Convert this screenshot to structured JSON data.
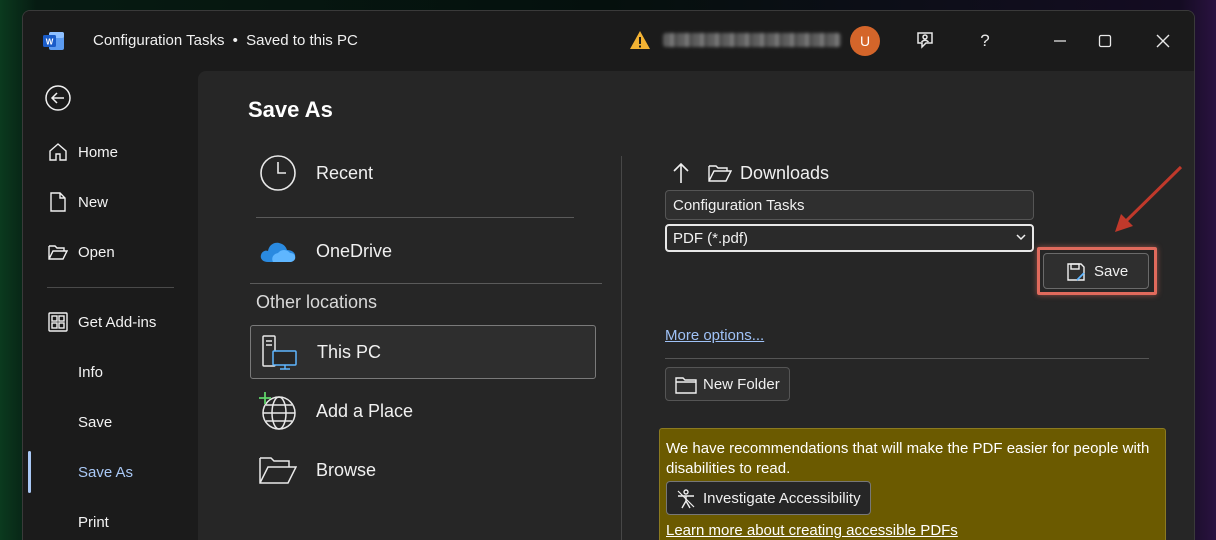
{
  "titlebar": {
    "doc_title": "Configuration Tasks",
    "separator": "•",
    "save_status": "Saved to this PC",
    "account_initial": "U",
    "account_name_redacted": "",
    "help_glyph": "?"
  },
  "nav": {
    "items": [
      {
        "label": "Home",
        "icon": "home-icon"
      },
      {
        "label": "New",
        "icon": "new-document-icon"
      },
      {
        "label": "Open",
        "icon": "open-folder-icon"
      },
      {
        "label": "Get Add-ins",
        "icon": "add-ins-icon"
      },
      {
        "label": "Info"
      },
      {
        "label": "Save"
      },
      {
        "label": "Save As"
      },
      {
        "label": "Print"
      }
    ],
    "active": "Save As"
  },
  "page": {
    "title": "Save As"
  },
  "locations": {
    "recent": "Recent",
    "onedrive": "OneDrive",
    "other_heading": "Other locations",
    "this_pc": "This PC",
    "add_place": "Add a Place",
    "browse": "Browse",
    "selected": "This PC"
  },
  "save_panel": {
    "current_folder": "Downloads",
    "filename": "Configuration Tasks",
    "filetype": "PDF (*.pdf)",
    "save_label": "Save",
    "more_options": "More options...",
    "new_folder": "New Folder"
  },
  "accessibility": {
    "message": "We have recommendations that will make the PDF easier for people with disabilities to read.",
    "investigate_label": "Investigate Accessibility",
    "learn_more": "Learn more about creating accessible PDFs"
  },
  "colors": {
    "accent": "#a9c8f5",
    "highlight_red": "#e06a5c",
    "warning_panel": "#6b5a00",
    "avatar": "#d4652a"
  }
}
